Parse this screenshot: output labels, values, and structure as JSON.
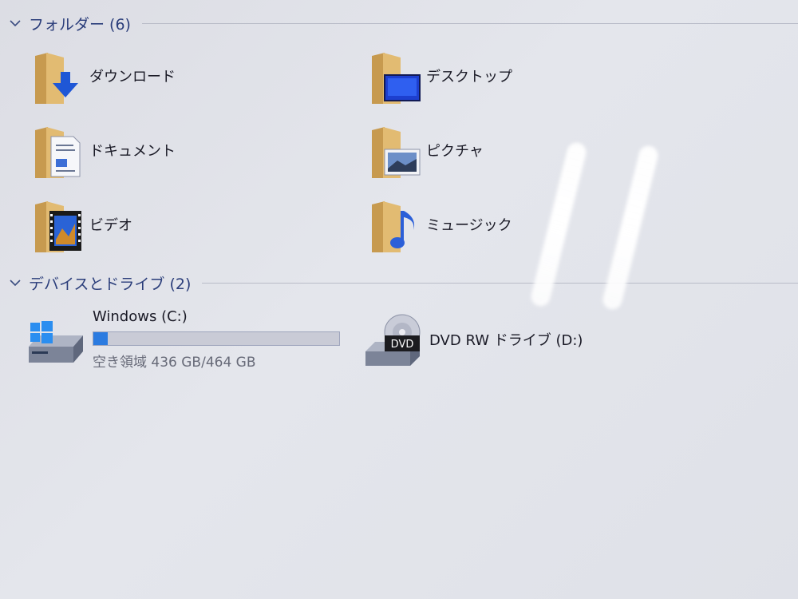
{
  "groups": {
    "folders": {
      "title": "フォルダー (6)",
      "items": [
        {
          "label": "ダウンロード",
          "icon": "downloads-folder-icon"
        },
        {
          "label": "デスクトップ",
          "icon": "desktop-folder-icon"
        },
        {
          "label": "ドキュメント",
          "icon": "documents-folder-icon"
        },
        {
          "label": "ピクチャ",
          "icon": "pictures-folder-icon"
        },
        {
          "label": "ビデオ",
          "icon": "videos-folder-icon"
        },
        {
          "label": "ミュージック",
          "icon": "music-folder-icon"
        }
      ]
    },
    "devices": {
      "title": "デバイスとドライブ (2)",
      "items": [
        {
          "label": "Windows (C:)",
          "free_text": "空き領域 436 GB/464 GB",
          "used_fraction": 0.06,
          "icon": "windows-drive-icon"
        },
        {
          "label": "DVD RW ドライブ (D:)",
          "icon": "dvd-drive-icon",
          "badge": "DVD"
        }
      ]
    }
  },
  "colors": {
    "header_text": "#2a3d7a",
    "capacity_fill": "#2b7be0",
    "folder_tan": "#d9b26d"
  }
}
